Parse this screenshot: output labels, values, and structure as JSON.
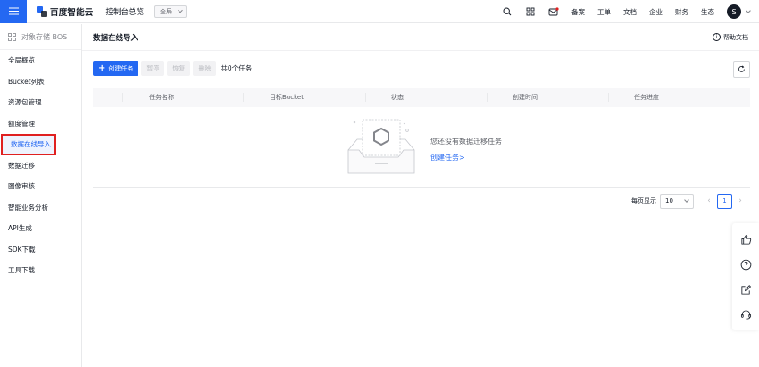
{
  "topbar": {
    "logo_text": "百度智能云",
    "console_link": "控制台总览",
    "region": "全局",
    "links": [
      "备案",
      "工单",
      "文档",
      "企业",
      "财务",
      "生态"
    ],
    "avatar": "S"
  },
  "sidebar": {
    "title": "对象存储 BOS",
    "items": [
      {
        "label": "全局概览"
      },
      {
        "label": "Bucket列表"
      },
      {
        "label": "资源包管理"
      },
      {
        "label": "额度管理"
      },
      {
        "label": "数据在线导入"
      },
      {
        "label": "数据迁移"
      },
      {
        "label": "图像审核"
      },
      {
        "label": "智能业务分析"
      },
      {
        "label": "API生成"
      },
      {
        "label": "SDK下载"
      },
      {
        "label": "工具下载"
      }
    ]
  },
  "main": {
    "title": "数据在线导入",
    "help": "帮助文档",
    "toolbar": {
      "create": "创建任务",
      "pause": "暂停",
      "resume": "恢复",
      "delete": "删除",
      "total": "共0个任务"
    },
    "table": {
      "columns": [
        "任务名称",
        "目标Bucket",
        "状态",
        "创建时间",
        "任务进度"
      ],
      "empty_text": "您还没有数据迁移任务",
      "empty_link": "创建任务>"
    },
    "pager": {
      "label": "每页显示",
      "page_size": "10",
      "current_page": "1"
    }
  },
  "colors": {
    "primary": "#2468f2",
    "highlight_box": "#e02020"
  }
}
